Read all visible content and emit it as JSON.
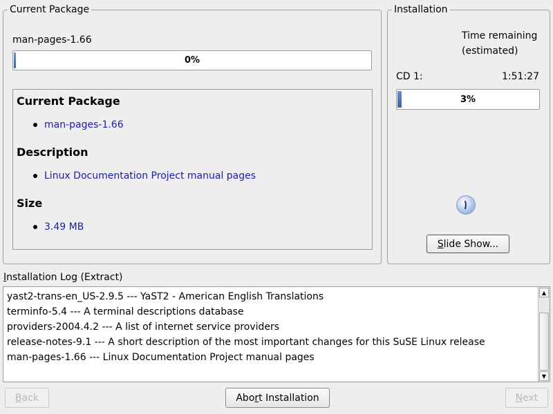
{
  "current_package": {
    "group_title": "Current Package",
    "package_name": "man-pages-1.66",
    "progress_text": "0%",
    "progress_fraction": 0.0
  },
  "details": {
    "package_heading": "Current Package",
    "package_value": "man-pages-1.66",
    "description_heading": "Description",
    "description_value": "Linux Documentation Project manual pages",
    "size_heading": "Size",
    "size_value": "3.49 MB"
  },
  "installation": {
    "group_title": "Installation",
    "time_remaining_line1": "Time remaining",
    "time_remaining_line2": "(estimated)",
    "cd_label": "CD 1:",
    "cd_time": "1:51:27",
    "progress_text": "3%",
    "progress_fraction": 0.03,
    "slideshow_button_pre": "",
    "slideshow_button_mnemonic": "S",
    "slideshow_button_post": "lide Show..."
  },
  "log": {
    "title_pre": "",
    "title_mnemonic": "I",
    "title_post": "nstallation Log (Extract)",
    "lines": [
      "yast2-trans-en_US-2.9.5 --- YaST2 - American English Translations",
      "terminfo-5.4 --- A terminal descriptions database",
      "providers-2004.4.2 --- A list of internet service providers",
      "release-notes-9.1 --- A short description of the most important changes for this SuSE Linux release",
      "man-pages-1.66 --- Linux Documentation Project manual pages"
    ]
  },
  "buttons": {
    "back_pre": "",
    "back_mnemonic": "B",
    "back_post": "ack",
    "abort_pre": "Abo",
    "abort_mnemonic": "r",
    "abort_post": "t Installation",
    "next_pre": "",
    "next_mnemonic": "N",
    "next_post": "ext"
  },
  "icons": {
    "busy": "busy-clock-icon",
    "scroll_up": "scroll-up-arrow-icon",
    "scroll_down": "scroll-down-arrow-icon"
  },
  "colors": {
    "progress_fill": "#3d62a6",
    "link_text": "#1a1ab0",
    "background": "#eeeeee"
  }
}
